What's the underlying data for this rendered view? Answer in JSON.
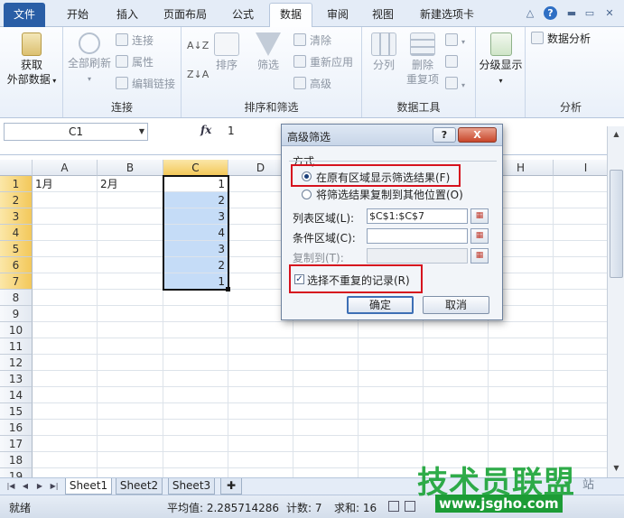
{
  "tabs": [
    "文件",
    "开始",
    "插入",
    "页面布局",
    "公式",
    "数据",
    "审阅",
    "视图",
    "新建选项卡"
  ],
  "active_tab": "数据",
  "ribbon": {
    "get_external": {
      "label_line1": "获取",
      "label_line2": "外部数据"
    },
    "refresh_all": "全部刷新",
    "connections": "连接",
    "properties": "属性",
    "edit_links": "编辑链接",
    "group_connections": "连接",
    "sort_label": "排序",
    "filter_label": "筛选",
    "clear": "清除",
    "reapply": "重新应用",
    "advanced": "高级",
    "group_sort_filter": "排序和筛选",
    "split": "分列",
    "remove_dup_line1": "删除",
    "remove_dup_line2": "重复项",
    "group_data_tools": "数据工具",
    "outline": "分级显示",
    "data_analysis": "数据分析",
    "group_analysis": "分析"
  },
  "formula_bar": {
    "name_box": "C1",
    "fx": "fx",
    "value": "1"
  },
  "sheet": {
    "columns": [
      "A",
      "B",
      "C",
      "D",
      "E",
      "F",
      "G",
      "H",
      "I"
    ],
    "selected_column": "C",
    "rows": [
      "1",
      "2",
      "3",
      "4",
      "5",
      "6",
      "7",
      "8",
      "9",
      "10",
      "11",
      "12",
      "13",
      "14",
      "15",
      "16",
      "17",
      "18",
      "19"
    ],
    "cells": {
      "A1": "1月",
      "B1": "2月",
      "C": [
        "1",
        "2",
        "3",
        "4",
        "3",
        "2",
        "1"
      ]
    }
  },
  "sheet_tabs": [
    "Sheet1",
    "Sheet2",
    "Sheet3"
  ],
  "status": {
    "ready": "就绪",
    "average": "平均值: 2.285714286",
    "count": "计数: 7",
    "sum": "求和: 16"
  },
  "dialog": {
    "title": "高级筛选",
    "help": "?",
    "close": "X",
    "mode_label": "方式",
    "option_inplace": "在原有区域显示筛选结果(F)",
    "option_copy": "将筛选结果复制到其他位置(O)",
    "list_range_label": "列表区域(L):",
    "list_range_value": "$C$1:$C$7",
    "criteria_range_label": "条件区域(C):",
    "criteria_range_value": "",
    "copy_to_label": "复制到(T):",
    "unique_label": "选择不重复的记录(R)",
    "unique_checked": true,
    "ok": "确定",
    "cancel": "取消"
  },
  "watermark": {
    "big": "技术员联盟",
    "url": "www.jsgho.com",
    "corner": "站"
  }
}
